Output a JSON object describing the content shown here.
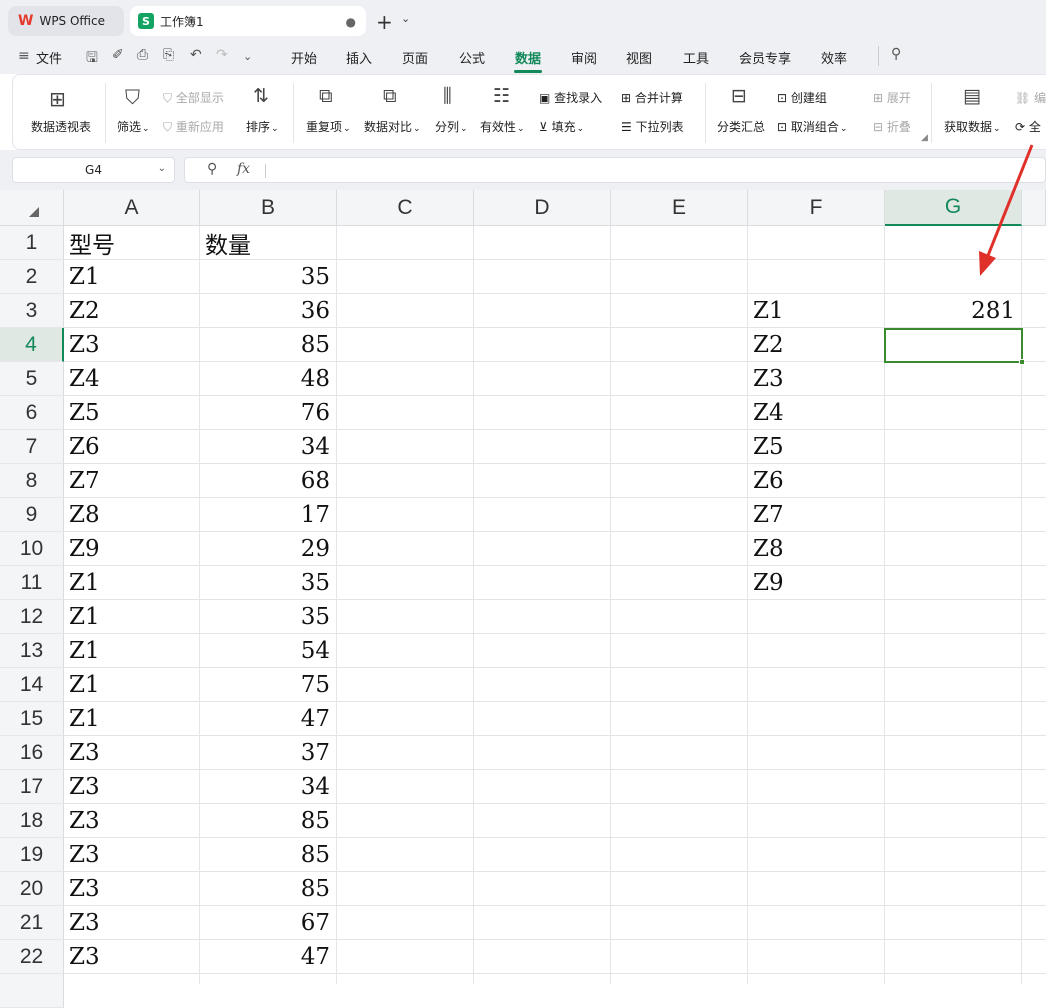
{
  "titlebar": {
    "app_tab": "WPS Office",
    "doc_tab": "工作簿1",
    "doc_icon": "S",
    "new_tab": "+"
  },
  "menu": {
    "file": "文件",
    "items": [
      "开始",
      "插入",
      "页面",
      "公式",
      "数据",
      "审阅",
      "视图",
      "工具",
      "会员专享",
      "效率"
    ],
    "active": "数据"
  },
  "ribbon": {
    "pivot": "数据透视表",
    "filter": "筛选",
    "show_all": "全部显示",
    "reapply": "重新应用",
    "sort": "排序",
    "dup": "重复项",
    "compare": "数据对比",
    "split": "分列",
    "validity": "有效性",
    "find_entry": "查找录入",
    "fill": "填充",
    "merge_calc": "合并计算",
    "dropdown_list": "下拉列表",
    "subtotal": "分类汇总",
    "create_group": "创建组",
    "ungroup": "取消组合",
    "expand": "展开",
    "fold": "折叠",
    "get_data": "获取数据",
    "edit_partial": "编",
    "all_partial": "全"
  },
  "formula_bar": {
    "name_box": "G4",
    "fx": "fx",
    "formula": ""
  },
  "sheet": {
    "columns": [
      "A",
      "B",
      "C",
      "D",
      "E",
      "F",
      "G"
    ],
    "selected_col": "G",
    "selected_row": "4",
    "rows": [
      "1",
      "2",
      "3",
      "4",
      "5",
      "6",
      "7",
      "8",
      "9",
      "10",
      "11",
      "12",
      "13",
      "14",
      "15",
      "16",
      "17",
      "18",
      "19",
      "20",
      "21",
      "22"
    ],
    "A": [
      "型号",
      "Z1",
      "Z2",
      "Z3",
      "Z4",
      "Z5",
      "Z6",
      "Z7",
      "Z8",
      "Z9",
      "Z1",
      "Z1",
      "Z1",
      "Z1",
      "Z1",
      "Z3",
      "Z3",
      "Z3",
      "Z3",
      "Z3",
      "Z3",
      "Z3"
    ],
    "B": [
      "数量",
      "35",
      "36",
      "85",
      "48",
      "76",
      "34",
      "68",
      "17",
      "29",
      "35",
      "35",
      "54",
      "75",
      "47",
      "37",
      "34",
      "85",
      "85",
      "85",
      "67",
      "47"
    ],
    "F": [
      "",
      "",
      "Z1",
      "Z2",
      "Z3",
      "Z4",
      "Z5",
      "Z6",
      "Z7",
      "Z8",
      "Z9",
      "",
      "",
      "",
      "",
      "",
      "",
      "",
      "",
      "",
      "",
      ""
    ],
    "G": [
      "",
      "",
      "281",
      "",
      "",
      "",
      "",
      "",
      "",
      "",
      "",
      "",
      "",
      "",
      "",
      "",
      "",
      "",
      "",
      "",
      "",
      ""
    ]
  },
  "colors": {
    "accent": "#13895a",
    "selection": "#3a8a2e",
    "arrow": "#e0302a"
  }
}
